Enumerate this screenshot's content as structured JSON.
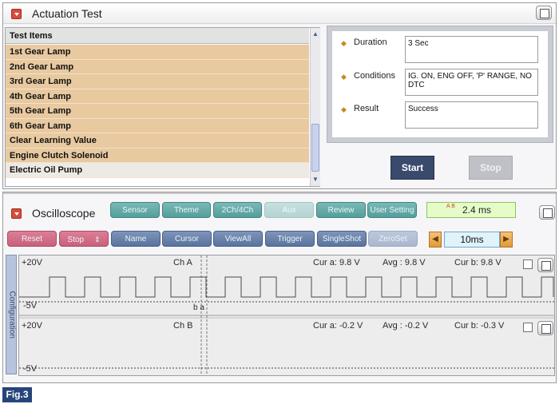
{
  "actuation": {
    "title": "Actuation Test",
    "list_header": "Test Items",
    "items": [
      "1st Gear Lamp",
      "2nd Gear Lamp",
      "3rd Gear Lamp",
      "4th Gear Lamp",
      "5th Gear Lamp",
      "6th Gear Lamp",
      "Clear Learning Value",
      "Engine Clutch Solenoid",
      "Electric Oil Pump"
    ],
    "selected_item": "Electric Oil Pump",
    "details": {
      "duration_label": "Duration",
      "duration_value": "3 Sec",
      "conditions_label": "Conditions",
      "conditions_value": "IG. ON, ENG OFF, 'P' RANGE, NO DTC",
      "result_label": "Result",
      "result_value": "Success"
    },
    "start_label": "Start",
    "stop_label": "Stop"
  },
  "oscilloscope": {
    "title": "Oscilloscope",
    "toolbar1": [
      "Sensor",
      "Theme",
      "2Ch/4Ch",
      "Aux",
      "Review",
      "User Setting"
    ],
    "toolbar1_disabled": [
      "Aux"
    ],
    "cursor_delta_icon": "A B",
    "cursor_delta": "2.4 ms",
    "toolbar2": [
      "Reset",
      "Stop",
      "Name",
      "Cursor",
      "ViewAll",
      "Trigger",
      "SingleShot",
      "ZeroSet"
    ],
    "toolbar2_disabled": [
      "ZeroSet"
    ],
    "timebase": "10ms",
    "config_tab_label": "Configuration",
    "channels": [
      {
        "name": "Ch A",
        "vmax": "+20V",
        "vmin": "-5V",
        "cur_a": "Cur a: 9.8 V",
        "avg": "Avg : 9.8 V",
        "cur_b": "Cur b: 9.8 V",
        "cursor_marker": "b a"
      },
      {
        "name": "Ch B",
        "vmax": "+20V",
        "vmin": "-5V",
        "cur_a": "Cur a: -0.2 V",
        "avg": "Avg : -0.2 V",
        "cur_b": "Cur b: -0.3 V"
      }
    ]
  },
  "figure_label": "Fig.3",
  "colors": {
    "list_item_bg": "#e8c9a0",
    "teal_button": "#64a8a5",
    "blue_button": "#6680ab",
    "pink_button": "#d06f89",
    "start_button": "#3a4a6c"
  }
}
